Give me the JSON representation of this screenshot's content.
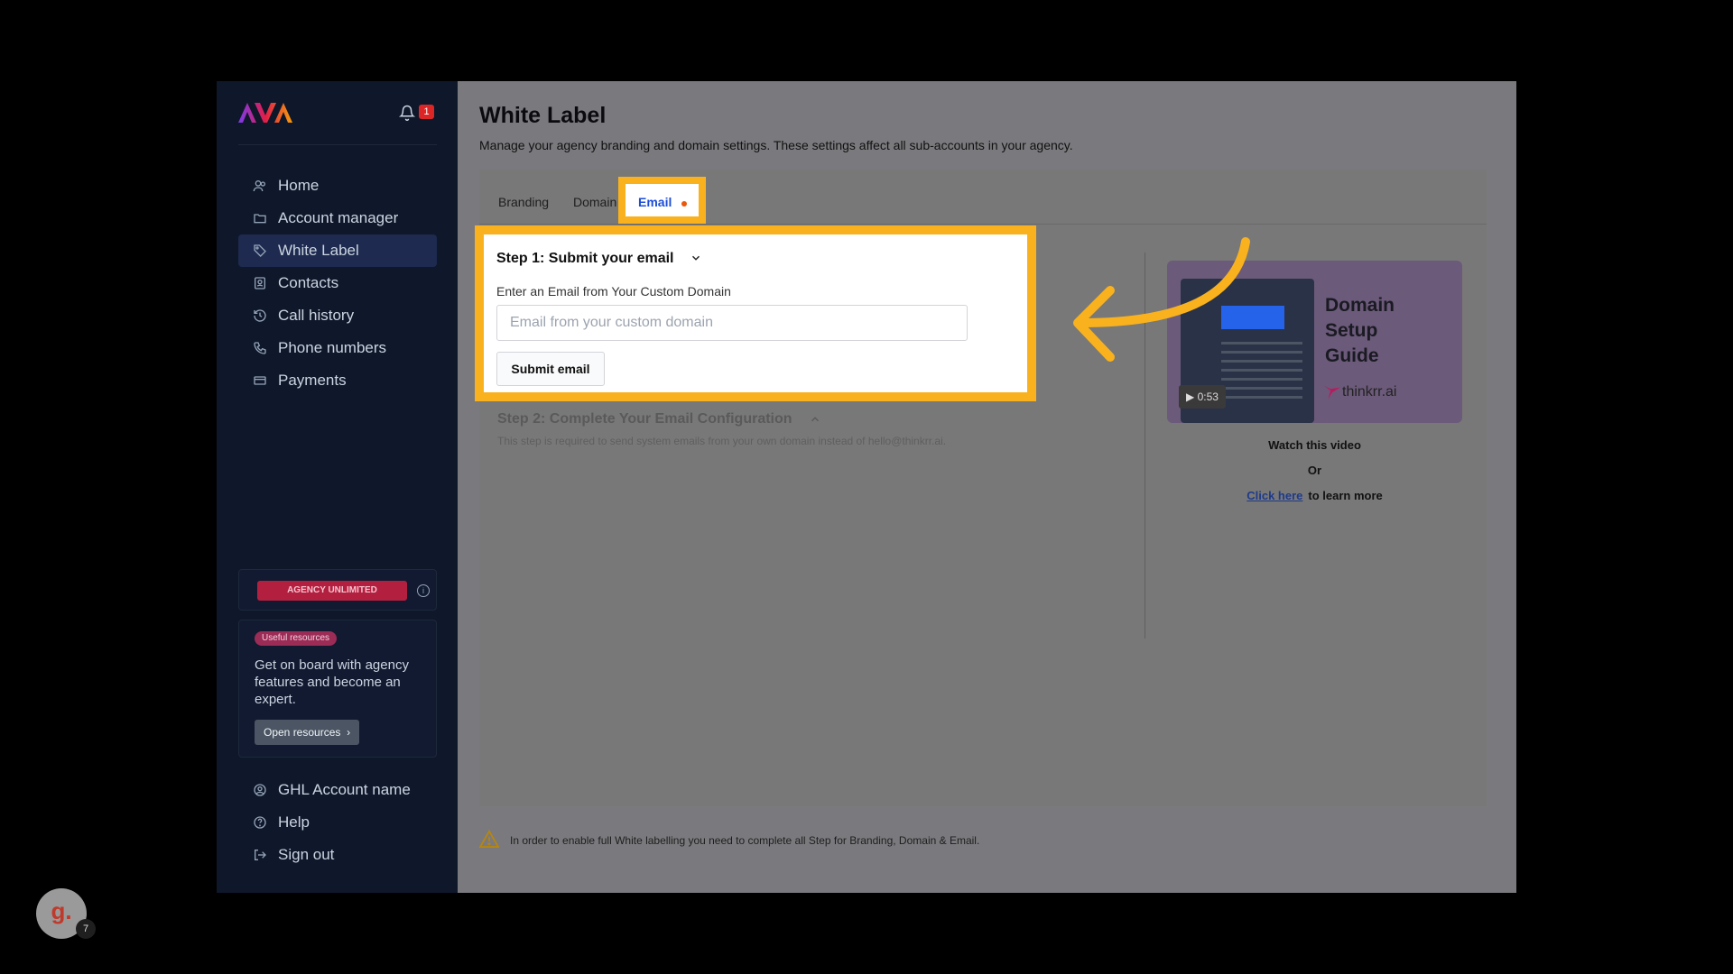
{
  "brand": {
    "logo_text": "AVA",
    "notification_count": "1"
  },
  "sidebar": {
    "items": [
      {
        "label": "Home",
        "icon": "users-icon"
      },
      {
        "label": "Account manager",
        "icon": "folder-icon"
      },
      {
        "label": "White Label",
        "icon": "tag-icon",
        "active": true
      },
      {
        "label": "Contacts",
        "icon": "contacts-icon"
      },
      {
        "label": "Call history",
        "icon": "history-icon"
      },
      {
        "label": "Phone numbers",
        "icon": "phone-icon"
      },
      {
        "label": "Payments",
        "icon": "card-icon"
      }
    ],
    "plan_badge": "AGENCY UNLIMITED",
    "resources": {
      "tag": "Useful resources",
      "text": "Get on board with agency features and become an expert.",
      "button": "Open resources"
    },
    "bottom_items": [
      {
        "label": "GHL Account name",
        "icon": "user-circle-icon"
      },
      {
        "label": "Help",
        "icon": "help-icon"
      },
      {
        "label": "Sign out",
        "icon": "sign-out-icon"
      }
    ]
  },
  "main": {
    "title": "White Label",
    "subtitle": "Manage your agency branding and domain settings. These settings affect all sub-accounts in your agency.",
    "tabs": [
      "Branding",
      "Domain",
      "Email"
    ],
    "step1": {
      "title": "Step 1: Submit your email",
      "label": "Enter an Email from Your Custom Domain",
      "placeholder": "Email from your custom domain",
      "button": "Submit email"
    },
    "step2": {
      "title": "Step 2: Complete Your Email Configuration",
      "description": "This step is required to send system emails from your own domain instead of hello@thinkrr.ai."
    },
    "video": {
      "title_lines": [
        "Domain",
        "Setup",
        "Guide"
      ],
      "brand": "thinkrr.ai",
      "duration": "0:53",
      "watch": "Watch this video",
      "or": "Or",
      "link": "Click here",
      "link_suffix": "to learn more"
    },
    "warning": "In order to enable full White labelling you need to complete all Step for Branding, Domain & Email."
  },
  "guide": {
    "letter": "g.",
    "count": "7"
  },
  "colors": {
    "highlight": "#f9b21d",
    "sidebar_bg": "#0f172a",
    "active_tab": "#1d4ed8"
  }
}
